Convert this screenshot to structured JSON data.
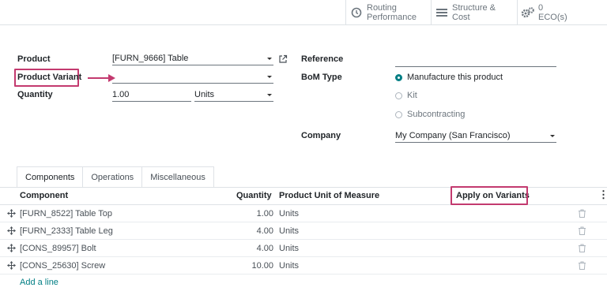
{
  "stat_buttons": [
    {
      "line1": "Routing",
      "line2": "Performance",
      "icon": "clock-icon"
    },
    {
      "line1": "Structure &",
      "line2": "Cost",
      "icon": "list-icon"
    },
    {
      "line1": "0",
      "line2": "ECO(s)",
      "icon": "gears-icon"
    }
  ],
  "form": {
    "product_label": "Product",
    "product_value": "[FURN_9666] Table",
    "variant_label": "Product Variant",
    "variant_value": "",
    "quantity_label": "Quantity",
    "quantity_value": "1.00",
    "uom_value": "Units",
    "reference_label": "Reference",
    "reference_value": "",
    "bom_type_label": "BoM Type",
    "bom_types": [
      "Manufacture this product",
      "Kit",
      "Subcontracting"
    ],
    "bom_type_selected": "Manufacture this product",
    "company_label": "Company",
    "company_value": "My Company (San Francisco)"
  },
  "tabs": [
    "Components",
    "Operations",
    "Miscellaneous"
  ],
  "active_tab": "Components",
  "table": {
    "headers": {
      "component": "Component",
      "quantity": "Quantity",
      "uom": "Product Unit of Measure",
      "variants": "Apply on Variants"
    },
    "rows": [
      {
        "component": "[FURN_8522] Table Top",
        "quantity": "1.00",
        "uom": "Units"
      },
      {
        "component": "[FURN_2333] Table Leg",
        "quantity": "4.00",
        "uom": "Units"
      },
      {
        "component": "[CONS_89957] Bolt",
        "quantity": "4.00",
        "uom": "Units"
      },
      {
        "component": "[CONS_25630] Screw",
        "quantity": "10.00",
        "uom": "Units"
      }
    ],
    "add_line": "Add a line"
  },
  "colors": {
    "accent": "#017e84",
    "highlight": "#c33a6f"
  }
}
